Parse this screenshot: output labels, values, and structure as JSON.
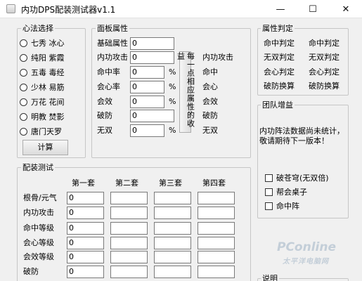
{
  "window": {
    "title": "内功DPS配装测试器v1.1",
    "minimize_label": "—",
    "maximize_label": "☐",
    "close_label": "✕"
  },
  "method_group": {
    "legend": "心法选择",
    "options": [
      "七秀 冰心",
      "纯阳 紫霞",
      "五毒 毒经",
      "少林 易筋",
      "万花 花间",
      "明教 焚影",
      "唐门天罗"
    ],
    "calc_button": "计算"
  },
  "panel_group": {
    "legend": "面板属性",
    "rows": [
      {
        "label": "基础属性",
        "value": "0",
        "unit": "",
        "gain": ""
      },
      {
        "label": "内功攻击",
        "value": "0",
        "unit": "",
        "gain": "内功攻击"
      },
      {
        "label": "命中率",
        "value": "0",
        "unit": "%",
        "gain": "命中"
      },
      {
        "label": "会心率",
        "value": "0",
        "unit": "%",
        "gain": "会心"
      },
      {
        "label": "会效",
        "value": "0",
        "unit": "%",
        "gain": "会效"
      },
      {
        "label": "破防",
        "value": "0",
        "unit": "",
        "gain": "破防"
      },
      {
        "label": "无双",
        "value": "0",
        "unit": "%",
        "gain": "无双"
      }
    ],
    "gain_button": "每一点相应属性的收益"
  },
  "attr_group": {
    "legend": "属性判定",
    "buttons": [
      "命中判定",
      "命中判定",
      "无双判定",
      "无双判定",
      "会心判定",
      "会心判定",
      "破防换算",
      "破防换算"
    ]
  },
  "team_group": {
    "legend": "团队增益",
    "notice": "内功阵法数据尚未统计，敬请期待下一版本！",
    "checks": [
      "破苍穹(无双倍)",
      "帮会桌子",
      "命中阵"
    ]
  },
  "equip_group": {
    "legend": "配装测试",
    "columns": [
      "第一套",
      "第二套",
      "第三套",
      "第四套"
    ],
    "rows": [
      {
        "label": "根骨/元气",
        "first": "0"
      },
      {
        "label": "内功攻击",
        "first": "0"
      },
      {
        "label": "命中等级",
        "first": "0"
      },
      {
        "label": "会心等级",
        "first": "0"
      },
      {
        "label": "会效等级",
        "first": "0"
      },
      {
        "label": "破防",
        "first": "0"
      }
    ]
  },
  "help_group": {
    "legend": "说明"
  },
  "watermark": {
    "brand": "PConline",
    "sub": "太平洋电脑网"
  }
}
